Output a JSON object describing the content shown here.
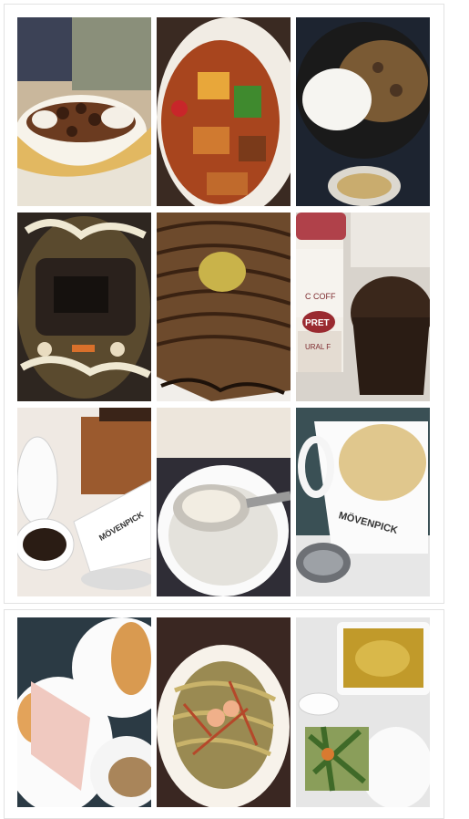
{
  "page": {
    "background": "#ffffff",
    "card_border": "#e2e2e2"
  },
  "grid_top": {
    "photos": [
      {
        "name": "photo-banana-split-dessert",
        "subject": "banana split ice cream with chocolate balls"
      },
      {
        "name": "photo-sweet-sour-vegetables",
        "subject": "stir-fried vegetables in red sauce"
      },
      {
        "name": "photo-rice-curry-plate",
        "subject": "rice with braised meat and soup cup"
      },
      {
        "name": "photo-beef-noodle-soup",
        "subject": "beef and seafood noodle soup"
      },
      {
        "name": "photo-chocolate-cake-slice",
        "subject": "marbled chocolate cake with sauce"
      },
      {
        "name": "photo-coffee-cup-muffin",
        "subject": "paper coffee cup and chocolate muffin"
      },
      {
        "name": "photo-coffee-beans-mug",
        "subject": "white mug with coffee beans"
      },
      {
        "name": "photo-dumpling-soup-spoon",
        "subject": "dumpling soup with spoon"
      },
      {
        "name": "photo-latte-cup",
        "subject": "latte in white cup with spoon"
      }
    ],
    "cup_brand_text": "MÖVENPICK",
    "paper_cup_text": [
      "C COFF",
      "PRET",
      "URAL F"
    ]
  },
  "grid_bottom": {
    "photos": [
      {
        "name": "photo-breakfast-pancake-ham",
        "subject": "pancakes ham and bun breakfast"
      },
      {
        "name": "photo-shrimp-noodles",
        "subject": "fried noodles with shrimp"
      },
      {
        "name": "photo-curry-rice-vegetables",
        "subject": "curry with rice and vegetables"
      }
    ]
  }
}
